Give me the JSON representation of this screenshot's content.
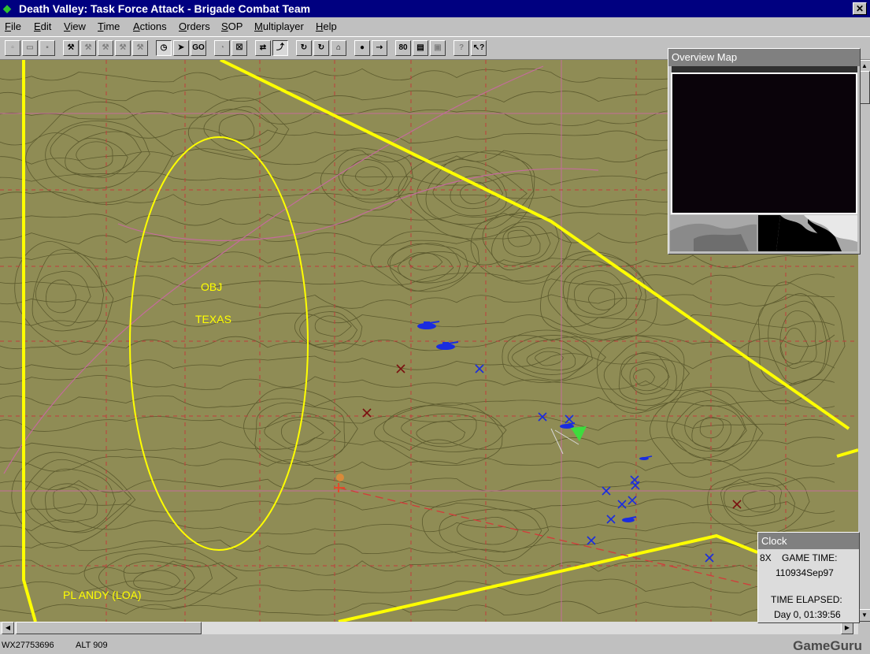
{
  "window": {
    "title": "Death Valley:  Task Force Attack - Brigade Combat Team",
    "app_icon": "tank-icon",
    "close_label": "✕"
  },
  "menu": [
    "File",
    "Edit",
    "View",
    "Time",
    "Actions",
    "Orders",
    "SOP",
    "Multiplayer",
    "Help"
  ],
  "toolbar": {
    "buttons": [
      {
        "name": "new-icon",
        "glyph": "▫"
      },
      {
        "name": "open-icon",
        "glyph": "▭"
      },
      {
        "name": "save-icon",
        "glyph": "▪"
      },
      {
        "name": "tool-icon",
        "glyph": "⚒"
      },
      {
        "name": "tool-icon",
        "glyph": "⚒"
      },
      {
        "name": "tool-icon",
        "glyph": "⚒"
      },
      {
        "name": "tool-icon",
        "glyph": "⚒"
      },
      {
        "name": "tool-icon",
        "glyph": "⚒"
      },
      {
        "name": "clock-icon",
        "glyph": "◷"
      },
      {
        "name": "arrow-icon",
        "glyph": "➤"
      },
      {
        "name": "go-icon",
        "glyph": "GO"
      },
      {
        "name": "timer-icon",
        "glyph": "◔"
      },
      {
        "name": "cancel-icon",
        "glyph": "☒"
      },
      {
        "name": "formation-icon",
        "glyph": "⇄"
      },
      {
        "name": "route-icon",
        "glyph": "⤴"
      },
      {
        "name": "loop-icon",
        "glyph": "↻"
      },
      {
        "name": "loop-icon",
        "glyph": "↻"
      },
      {
        "name": "cover-icon",
        "glyph": "⌂"
      },
      {
        "name": "stop-icon",
        "glyph": "●"
      },
      {
        "name": "link-icon",
        "glyph": "⇢"
      },
      {
        "name": "speed-icon",
        "glyph": "80"
      },
      {
        "name": "chart-icon",
        "glyph": "▤"
      },
      {
        "name": "camera-icon",
        "glyph": "▣"
      },
      {
        "name": "help-icon",
        "glyph": "?"
      },
      {
        "name": "context-help-icon",
        "glyph": "↖?"
      }
    ]
  },
  "map": {
    "labels": {
      "obj_line1": "OBJ",
      "obj_line2": "TEXAS",
      "phase_line": "PL ANDY (LOA)"
    },
    "colors": {
      "terrain": "#8f8c55",
      "contour": "#5c5a2e",
      "grid_solid": "#c46b9c",
      "grid_dashed": "#c03c3c",
      "boundary": "#ffff00",
      "friendly": "#1a2ce0",
      "enemy": "#7a1010"
    }
  },
  "overview": {
    "title": "Overview Map"
  },
  "clock": {
    "title": "Clock",
    "speed": "8X",
    "game_time_label": "GAME TIME:",
    "game_time": "110934Sep97",
    "elapsed_label": "TIME ELAPSED:",
    "elapsed": "Day 0, 01:39:56"
  },
  "status": {
    "grid": "WX27753696",
    "alt": "ALT  909"
  },
  "watermark": "GameGuru"
}
